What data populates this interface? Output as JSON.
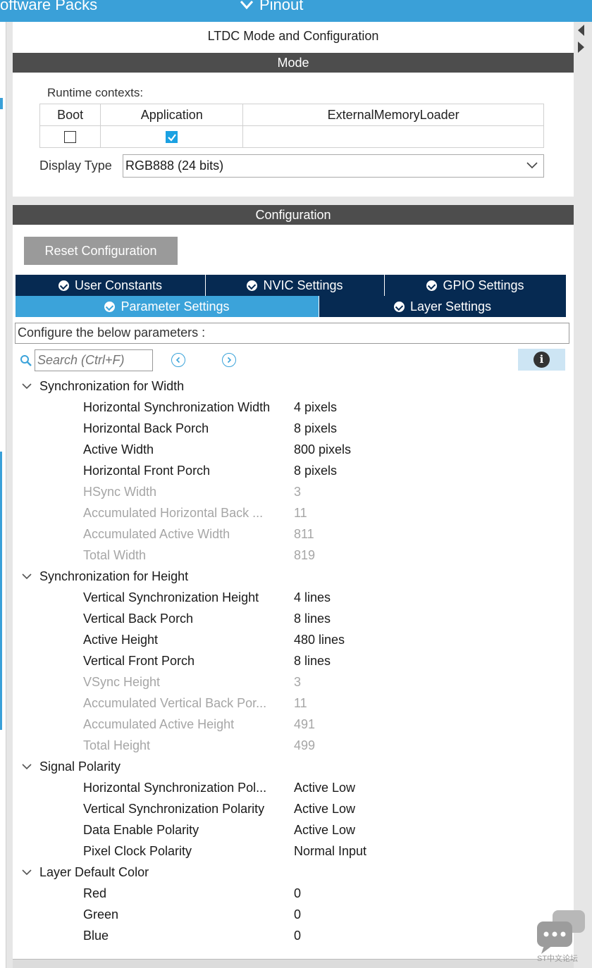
{
  "topbar": {
    "software_packs": "oftware Packs",
    "pinout": "Pinout"
  },
  "panel": {
    "title": "LTDC Mode and Configuration"
  },
  "mode": {
    "header": "Mode",
    "runtime_label": "Runtime contexts:",
    "contexts": [
      {
        "name": "Boot",
        "checked": false
      },
      {
        "name": "Application",
        "checked": true
      },
      {
        "name": "ExternalMemoryLoader",
        "checked": null
      }
    ],
    "display_type_label": "Display Type",
    "display_type_value": "RGB888 (24 bits)"
  },
  "configuration": {
    "header": "Configuration",
    "reset_label": "Reset Configuration",
    "tabs": {
      "user_constants": "User Constants",
      "nvic": "NVIC Settings",
      "gpio": "GPIO Settings",
      "parameter": "Parameter Settings",
      "layer": "Layer Settings"
    },
    "hint": "Configure the below parameters :",
    "search_placeholder": "Search (Ctrl+F)"
  },
  "groups": {
    "width": {
      "title": "Synchronization for Width",
      "rows": [
        {
          "name": "Horizontal Synchronization Width",
          "value": "4 pixels"
        },
        {
          "name": "Horizontal Back Porch",
          "value": "8 pixels"
        },
        {
          "name": "Active Width",
          "value": "800 pixels"
        },
        {
          "name": "Horizontal Front Porch",
          "value": "8 pixels"
        },
        {
          "name": "HSync Width",
          "value": "3"
        },
        {
          "name": "Accumulated Horizontal Back ...",
          "value": "11"
        },
        {
          "name": "Accumulated Active Width",
          "value": "811"
        },
        {
          "name": "Total Width",
          "value": "819"
        }
      ]
    },
    "height": {
      "title": "Synchronization for Height",
      "rows": [
        {
          "name": "Vertical Synchronization Height",
          "value": "4 lines"
        },
        {
          "name": "Vertical Back Porch",
          "value": "8 lines"
        },
        {
          "name": "Active Height",
          "value": "480 lines"
        },
        {
          "name": "Vertical Front Porch",
          "value": "8 lines"
        },
        {
          "name": "VSync Height",
          "value": "3"
        },
        {
          "name": "Accumulated Vertical Back Por...",
          "value": "11"
        },
        {
          "name": "Accumulated Active Height",
          "value": "491"
        },
        {
          "name": "Total Height",
          "value": "499"
        }
      ]
    },
    "polarity": {
      "title": "Signal Polarity",
      "rows": [
        {
          "name": "Horizontal Synchronization Pol...",
          "value": "Active Low"
        },
        {
          "name": "Vertical Synchronization Polarity",
          "value": "Active Low"
        },
        {
          "name": "Data Enable Polarity",
          "value": "Active Low"
        },
        {
          "name": "Pixel Clock Polarity",
          "value": "Normal Input"
        }
      ]
    },
    "color": {
      "title": "Layer Default Color",
      "rows": [
        {
          "name": "Red",
          "value": "0"
        },
        {
          "name": "Green",
          "value": "0"
        },
        {
          "name": "Blue",
          "value": "0"
        }
      ]
    }
  },
  "watermark": {
    "label": "ST中文论坛"
  }
}
